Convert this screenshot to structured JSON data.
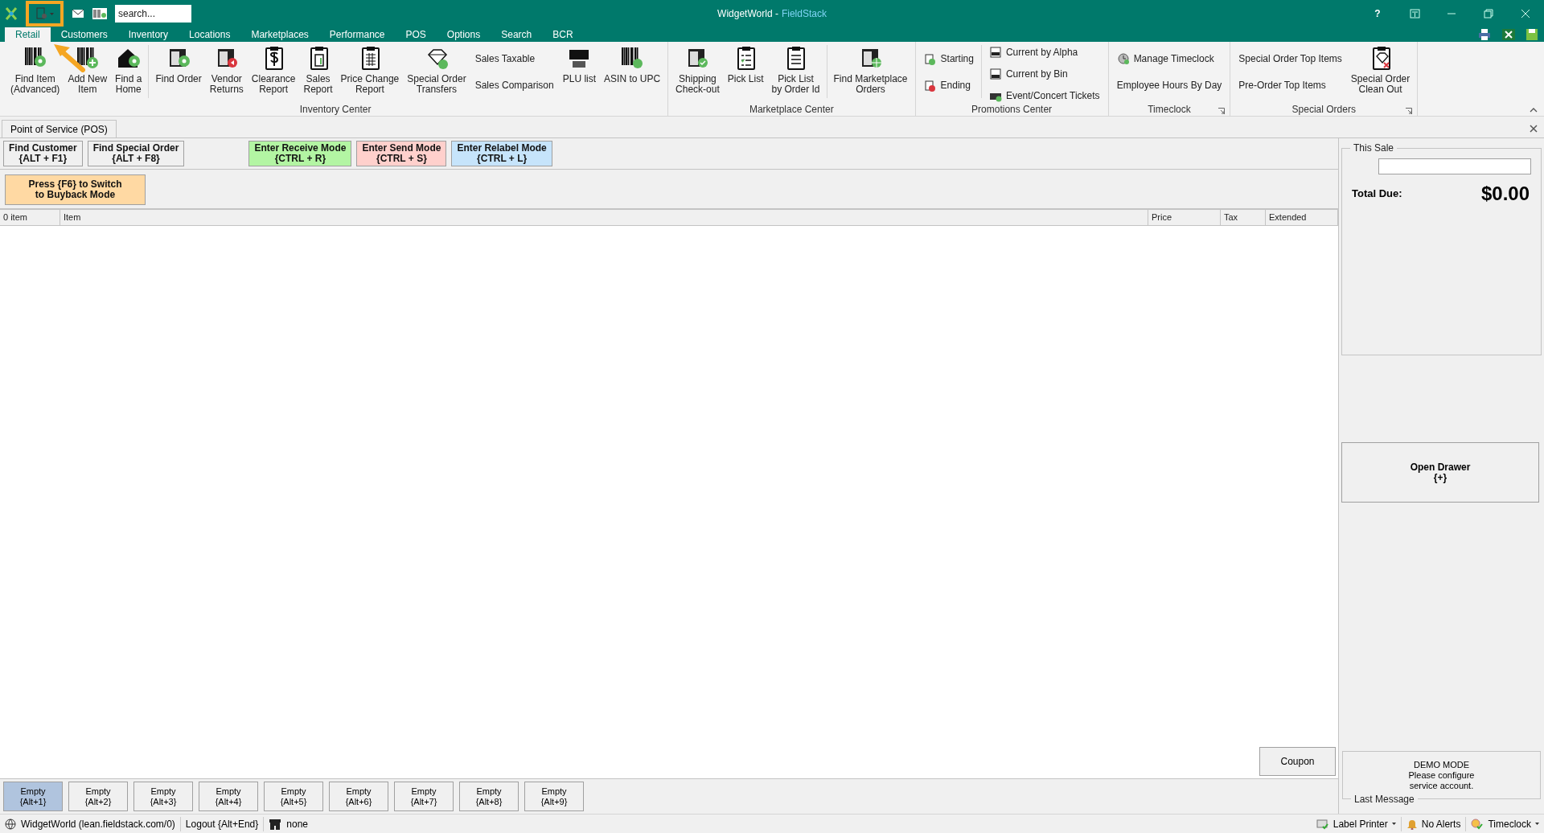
{
  "window": {
    "title_app": "WidgetWorld -",
    "title_product": "FieldStack",
    "help": "?"
  },
  "quick_access": {
    "search": {
      "placeholder": "search..."
    }
  },
  "tabs": [
    {
      "label": "Retail",
      "selected": true
    },
    {
      "label": "Customers",
      "selected": false
    },
    {
      "label": "Inventory",
      "selected": false
    },
    {
      "label": "Locations",
      "selected": false
    },
    {
      "label": "Marketplaces",
      "selected": false
    },
    {
      "label": "Performance",
      "selected": false
    },
    {
      "label": "POS",
      "selected": false
    },
    {
      "label": "Options",
      "selected": false
    },
    {
      "label": "Search",
      "selected": false
    },
    {
      "label": "BCR",
      "selected": false
    }
  ],
  "ribbon": {
    "groups": [
      {
        "label": "Inventory Center",
        "launcher": false,
        "items": [
          {
            "kind": "large",
            "label": "Find Item\n(Advanced)"
          },
          {
            "kind": "large",
            "label": "Add New\nItem"
          },
          {
            "kind": "large",
            "label": "Find a\nHome"
          },
          {
            "kind": "separator"
          },
          {
            "kind": "large",
            "label": "Find Order"
          },
          {
            "kind": "large",
            "label": "Vendor\nReturns"
          },
          {
            "kind": "large",
            "label": "Clearance\nReport"
          },
          {
            "kind": "large",
            "label": "Sales\nReport"
          },
          {
            "kind": "large",
            "label": "Price Change\nReport"
          },
          {
            "kind": "large",
            "label": "Special Order\nTransfers"
          },
          {
            "kind": "stack",
            "items": [
              {
                "label": "Sales Taxable",
                "icon": false
              },
              {
                "label": "Sales Comparison",
                "icon": false
              }
            ]
          },
          {
            "kind": "large",
            "label": "PLU list"
          },
          {
            "kind": "large",
            "label": "ASIN to UPC"
          }
        ]
      },
      {
        "label": "Marketplace Center",
        "launcher": false,
        "items": [
          {
            "kind": "large",
            "label": "Shipping\nCheck-out"
          },
          {
            "kind": "large",
            "label": "Pick List"
          },
          {
            "kind": "large",
            "label": "Pick List\nby Order Id"
          },
          {
            "kind": "separator"
          },
          {
            "kind": "large",
            "label": "Find Marketplace\nOrders"
          }
        ]
      },
      {
        "label": "Promotions Center",
        "launcher": false,
        "items": [
          {
            "kind": "stack",
            "items": [
              {
                "label": "Starting",
                "icon": true
              },
              {
                "label": "Ending",
                "icon": true
              }
            ]
          },
          {
            "kind": "separator"
          },
          {
            "kind": "stack",
            "items": [
              {
                "label": "Current by Alpha",
                "icon": true
              },
              {
                "label": "Current by Bin",
                "icon": true
              },
              {
                "label": "Event/Concert Tickets",
                "icon": true
              }
            ]
          }
        ]
      },
      {
        "label": "Timeclock",
        "launcher": true,
        "items": [
          {
            "kind": "stack",
            "items": [
              {
                "label": "Manage Timeclock",
                "icon": true
              },
              {
                "label": "Employee Hours By Day",
                "icon": false
              }
            ]
          }
        ]
      },
      {
        "label": "Special Orders",
        "launcher": true,
        "items": [
          {
            "kind": "stack",
            "items": [
              {
                "label": "Special Order Top Items",
                "icon": false
              },
              {
                "label": "Pre-Order Top Items",
                "icon": false
              }
            ]
          },
          {
            "kind": "large",
            "label": "Special Order\nClean Out"
          }
        ]
      }
    ]
  },
  "document_tab": {
    "label": "Point of Service (POS)"
  },
  "pos": {
    "actions": [
      {
        "label": "Find Customer\n{ALT + F1}",
        "color": "#f0f0f0"
      },
      {
        "label": "Find Special Order\n{ALT + F8}",
        "color": "#f0f0f0"
      },
      {
        "label": "Enter Receive Mode\n{CTRL + R}",
        "color": "#b3f5a3"
      },
      {
        "label": "Enter Send Mode\n{CTRL + S}",
        "color": "#ffd0cc"
      },
      {
        "label": "Enter Relabel Mode\n{CTRL + L}",
        "color": "#c6e4fb"
      }
    ],
    "buyback": "Press {F6} to Switch\nto Buyback Mode",
    "table": {
      "columns": [
        "0 item",
        "Item",
        "Price",
        "Tax",
        "Extended"
      ]
    },
    "coupon": "Coupon",
    "slots": [
      {
        "label": "Empty\n{Alt+1}",
        "selected": true
      },
      {
        "label": "Empty\n{Alt+2}",
        "selected": false
      },
      {
        "label": "Empty\n{Alt+3}",
        "selected": false
      },
      {
        "label": "Empty\n{Alt+4}",
        "selected": false
      },
      {
        "label": "Empty\n{Alt+5}",
        "selected": false
      },
      {
        "label": "Empty\n{Alt+6}",
        "selected": false
      },
      {
        "label": "Empty\n{Alt+7}",
        "selected": false
      },
      {
        "label": "Empty\n{Alt+8}",
        "selected": false
      },
      {
        "label": "Empty\n{Alt+9}",
        "selected": false
      }
    ]
  },
  "sale": {
    "legend": "This Sale",
    "total_label": "Total Due:",
    "total": "$0.00",
    "drawer": "Open Drawer\n{+}",
    "last_message_legend": "Last Message",
    "last_message": "DEMO MODE\nPlease configure\nservice account."
  },
  "status_bar": {
    "left": [
      {
        "kind": "globe",
        "label": "WidgetWorld (lean.fieldstack.com/0)"
      },
      {
        "kind": "plain",
        "label": "Logout {Alt+End}"
      },
      {
        "kind": "store",
        "label": "none"
      }
    ],
    "right": [
      {
        "kind": "printer",
        "label": "Label Printer",
        "dropdown": true
      },
      {
        "kind": "bell",
        "label": "No Alerts",
        "dropdown": false
      },
      {
        "kind": "clock",
        "label": "Timeclock",
        "dropdown": true
      }
    ]
  }
}
